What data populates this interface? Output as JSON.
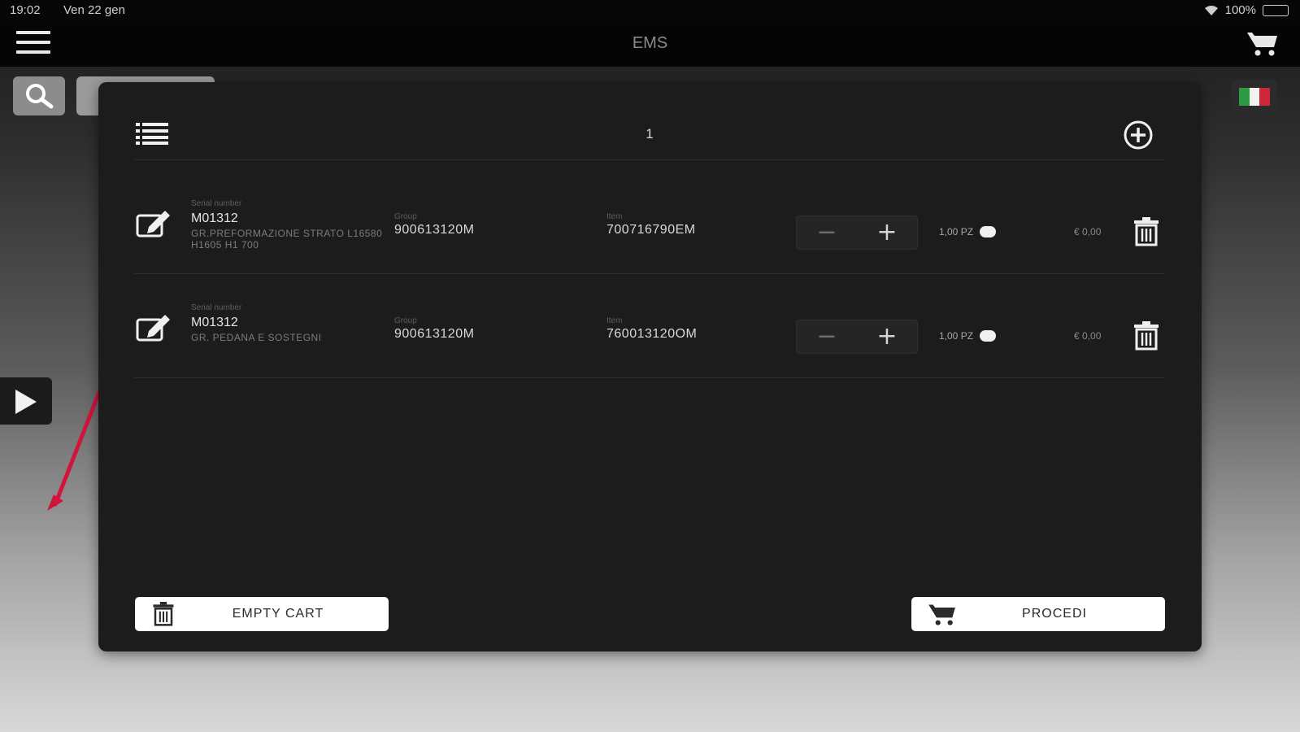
{
  "status_bar": {
    "time": "19:02",
    "date": "Ven 22 gen",
    "battery": "100%"
  },
  "nav": {
    "title": "EMS"
  },
  "cart_modal": {
    "title": "1",
    "items": [
      {
        "serial_label": "Serial number",
        "serial": "M01312",
        "description": "GR.PREFORMAZIONE STRATO L16580 H1605 H1 700",
        "group_label": "Group",
        "group": "900613120M",
        "item_label": "Item",
        "item": "700716790EM",
        "quantity": "1,00 PZ",
        "price": "€ 0,00"
      },
      {
        "serial_label": "Serial number",
        "serial": "M01312",
        "description": "GR. PEDANA E SOSTEGNI",
        "group_label": "Group",
        "group": "900613120M",
        "item_label": "Item",
        "item": "760013120OM",
        "quantity": "1,00 PZ",
        "price": "€ 0,00"
      }
    ],
    "empty_cart_label": "EMPTY CART",
    "proceed_label": "PROCEDI"
  },
  "colors": {
    "modal_bg": "#1c1c1c",
    "navbar_bg": "#050505",
    "button_bg": "#ffffff",
    "annotation_arrow": "#d2143c",
    "flag": [
      "#2e9a43",
      "#f2f2f2",
      "#d0263a"
    ]
  },
  "icons": {
    "menu": "hamburger-menu-icon",
    "cart": "shopping-cart-icon",
    "search": "magnifier-icon",
    "list": "list-icon",
    "add": "plus-circle-icon",
    "edit": "pencil-square-icon",
    "trash": "trash-icon",
    "play": "play-triangle-icon",
    "flag": "italy-flag-icon"
  }
}
